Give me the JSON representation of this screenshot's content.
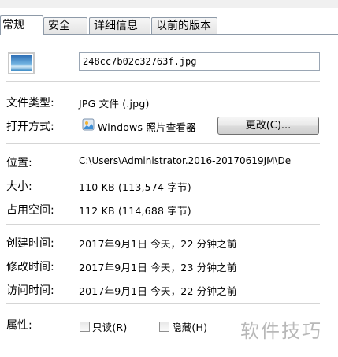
{
  "tabs": [
    "常规",
    "安全",
    "详细信息",
    "以前的版本"
  ],
  "file": {
    "name": "248cc7b02c32763f.jpg"
  },
  "labels": {
    "type": "文件类型:",
    "open_with": "打开方式:",
    "location": "位置:",
    "size": "大小:",
    "size_on_disk": "占用空间:",
    "created": "创建时间:",
    "modified": "修改时间:",
    "accessed": "访问时间:",
    "attributes": "属性:"
  },
  "values": {
    "type": "JPG 文件 (.jpg)",
    "open_with_app": "Windows 照片查看器",
    "change_button": "更改(C)...",
    "location": "C:\\Users\\Administrator.2016-20170619JM\\De",
    "size": "110 KB (113,574 字节)",
    "size_on_disk": "112 KB (114,688 字节)",
    "created": "2017年9月1日 今天，22 分钟之前",
    "modified": "2017年9月1日 今天，23 分钟之前",
    "accessed": "2017年9月1日 今天，22 分钟之前"
  },
  "attributes": {
    "readonly": "只读(R)",
    "hidden": "隐藏(H)"
  },
  "watermark": "软件技巧",
  "icons": {
    "file": "jpg-image-icon",
    "app": "photo-viewer-icon"
  }
}
